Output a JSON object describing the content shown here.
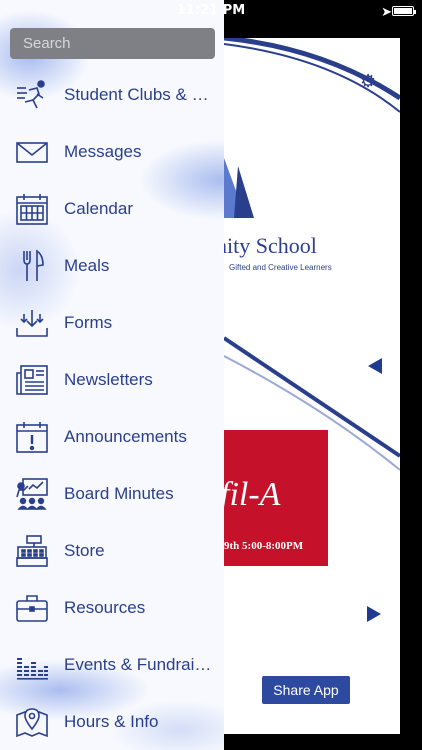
{
  "status_bar": {
    "time": "11:21 PM"
  },
  "search": {
    "placeholder": "Search"
  },
  "menu": {
    "items": [
      {
        "label": "Student Clubs & Organizations",
        "icon": "runner-icon"
      },
      {
        "label": "Messages",
        "icon": "envelope-icon"
      },
      {
        "label": "Calendar",
        "icon": "calendar-icon"
      },
      {
        "label": "Meals",
        "icon": "fork-knife-icon"
      },
      {
        "label": "Forms",
        "icon": "download-tray-icon"
      },
      {
        "label": "Newsletters",
        "icon": "newspaper-icon"
      },
      {
        "label": "Announcements",
        "icon": "calendar-alert-icon"
      },
      {
        "label": "Board Minutes",
        "icon": "presentation-icon"
      },
      {
        "label": "Store",
        "icon": "cash-register-icon"
      },
      {
        "label": "Resources",
        "icon": "briefcase-icon"
      },
      {
        "label": "Events & Fundraisers",
        "icon": "bar-graph-icon"
      },
      {
        "label": "Hours & Info",
        "icon": "map-pin-icon"
      }
    ]
  },
  "background_app": {
    "school_name": "nunity School",
    "school_tagline": "Gifted and Creative Learners",
    "promo_logo": "fil-A",
    "promo_hours": "9th 5:00-8:00PM",
    "share_label": "Share App"
  },
  "colors": {
    "accent": "#2a3f8c",
    "promo_red": "#c5112a",
    "share_button": "#2d4aa0",
    "search_bg": "#7f7f86"
  }
}
